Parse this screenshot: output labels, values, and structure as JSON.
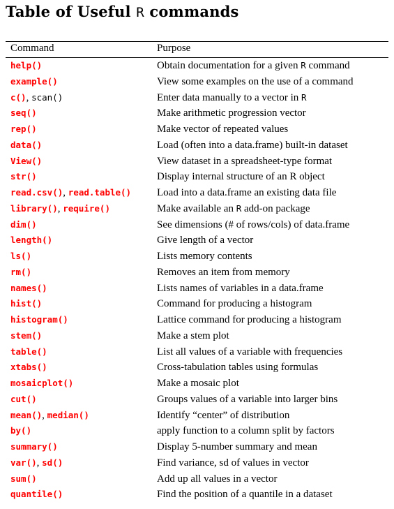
{
  "title": {
    "prefix": "Table of Useful ",
    "code": "R",
    "suffix": " commands"
  },
  "table": {
    "headers": {
      "command": "Command",
      "purpose": "Purpose"
    },
    "rows": [
      {
        "commands": [
          {
            "text": "help()",
            "red": true
          }
        ],
        "purpose": [
          {
            "t": "Obtain documentation for a given "
          },
          {
            "t": "R",
            "code": true
          },
          {
            "t": " command"
          }
        ]
      },
      {
        "commands": [
          {
            "text": "example()",
            "red": true
          }
        ],
        "purpose": [
          {
            "t": "View some examples on the use of a command"
          }
        ]
      },
      {
        "commands": [
          {
            "text": "c()",
            "red": true
          },
          {
            "text": "scan()",
            "red": false
          }
        ],
        "purpose": [
          {
            "t": "Enter data manually to a vector in "
          },
          {
            "t": "R",
            "code": true
          }
        ]
      },
      {
        "commands": [
          {
            "text": "seq()",
            "red": true
          }
        ],
        "purpose": [
          {
            "t": "Make arithmetic progression vector"
          }
        ]
      },
      {
        "commands": [
          {
            "text": "rep()",
            "red": true
          }
        ],
        "purpose": [
          {
            "t": "Make vector of repeated values"
          }
        ]
      },
      {
        "commands": [
          {
            "text": "data()",
            "red": true
          }
        ],
        "purpose": [
          {
            "t": "Load (often into a data.frame) built-in dataset"
          }
        ]
      },
      {
        "commands": [
          {
            "text": "View()",
            "red": true
          }
        ],
        "purpose": [
          {
            "t": "View dataset in a spreadsheet-type format"
          }
        ]
      },
      {
        "commands": [
          {
            "text": "str()",
            "red": true
          }
        ],
        "purpose": [
          {
            "t": "Display internal structure of an R object"
          }
        ]
      },
      {
        "commands": [
          {
            "text": "read.csv()",
            "red": true
          },
          {
            "text": "read.table()",
            "red": true
          }
        ],
        "purpose": [
          {
            "t": "Load into a data.frame an existing data file"
          }
        ]
      },
      {
        "commands": [
          {
            "text": "library()",
            "red": true
          },
          {
            "text": "require()",
            "red": true
          }
        ],
        "purpose": [
          {
            "t": "Make available an "
          },
          {
            "t": "R",
            "code": true
          },
          {
            "t": " add-on package"
          }
        ]
      },
      {
        "commands": [
          {
            "text": "dim()",
            "red": true
          }
        ],
        "purpose": [
          {
            "t": "See dimensions (# of rows/cols) of data.frame"
          }
        ]
      },
      {
        "commands": [
          {
            "text": "length()",
            "red": true
          }
        ],
        "purpose": [
          {
            "t": "Give length of a vector"
          }
        ]
      },
      {
        "commands": [
          {
            "text": "ls()",
            "red": true
          }
        ],
        "purpose": [
          {
            "t": "Lists memory contents"
          }
        ]
      },
      {
        "commands": [
          {
            "text": "rm()",
            "red": true
          }
        ],
        "purpose": [
          {
            "t": "Removes an item from memory"
          }
        ]
      },
      {
        "commands": [
          {
            "text": "names()",
            "red": true
          }
        ],
        "purpose": [
          {
            "t": "Lists names of variables in a data.frame"
          }
        ]
      },
      {
        "commands": [
          {
            "text": "hist()",
            "red": true
          }
        ],
        "purpose": [
          {
            "t": "Command for producing a histogram"
          }
        ]
      },
      {
        "commands": [
          {
            "text": "histogram()",
            "red": true
          }
        ],
        "purpose": [
          {
            "t": "Lattice command for producing a histogram"
          }
        ]
      },
      {
        "commands": [
          {
            "text": "stem()",
            "red": true
          }
        ],
        "purpose": [
          {
            "t": "Make a stem plot"
          }
        ]
      },
      {
        "commands": [
          {
            "text": "table()",
            "red": true
          }
        ],
        "purpose": [
          {
            "t": "List all values of a variable with frequencies"
          }
        ]
      },
      {
        "commands": [
          {
            "text": "xtabs()",
            "red": true
          }
        ],
        "purpose": [
          {
            "t": "Cross-tabulation tables using formulas"
          }
        ]
      },
      {
        "commands": [
          {
            "text": "mosaicplot()",
            "red": true
          }
        ],
        "purpose": [
          {
            "t": "Make a mosaic plot"
          }
        ]
      },
      {
        "commands": [
          {
            "text": "cut()",
            "red": true
          }
        ],
        "purpose": [
          {
            "t": "Groups values of a variable into larger bins"
          }
        ]
      },
      {
        "commands": [
          {
            "text": "mean()",
            "red": true
          },
          {
            "text": "median()",
            "red": true
          }
        ],
        "purpose": [
          {
            "t": "Identify “center” of distribution"
          }
        ]
      },
      {
        "commands": [
          {
            "text": "by()",
            "red": true
          }
        ],
        "purpose": [
          {
            "t": "apply function to a column split by factors"
          }
        ]
      },
      {
        "commands": [
          {
            "text": "summary()",
            "red": true
          }
        ],
        "purpose": [
          {
            "t": "Display 5-number summary and mean"
          }
        ]
      },
      {
        "commands": [
          {
            "text": "var()",
            "red": true
          },
          {
            "text": "sd()",
            "red": true
          }
        ],
        "purpose": [
          {
            "t": "Find variance, sd of values in vector"
          }
        ]
      },
      {
        "commands": [
          {
            "text": "sum()",
            "red": true
          }
        ],
        "purpose": [
          {
            "t": "Add up all values in a vector"
          }
        ]
      },
      {
        "commands": [
          {
            "text": "quantile()",
            "red": true
          }
        ],
        "purpose": [
          {
            "t": "Find the position of a quantile in a dataset"
          }
        ]
      }
    ]
  },
  "colors": {
    "command_red": "#ff0000",
    "text": "#000000"
  }
}
